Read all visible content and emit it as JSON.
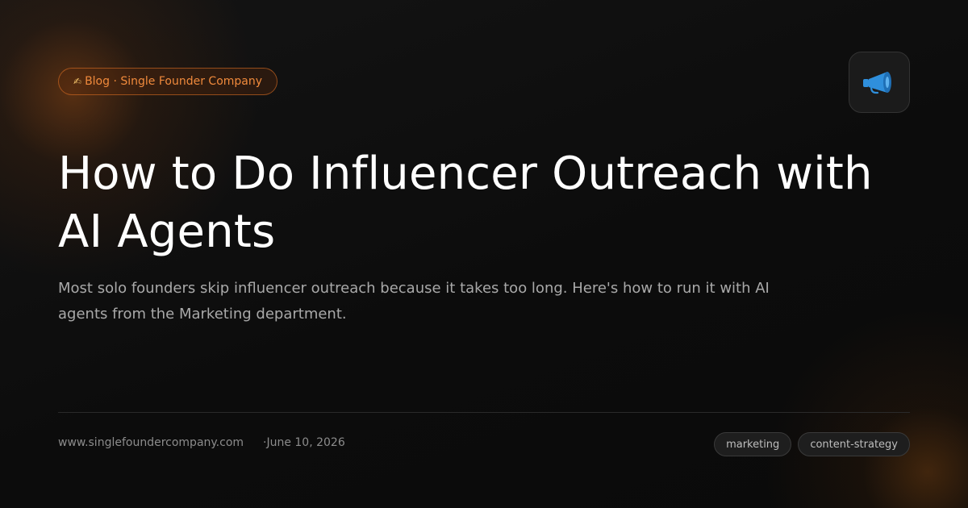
{
  "badge": {
    "icon": "writing-hand-icon",
    "text": "Blog · Single Founder Company"
  },
  "app_icon": "megaphone-icon",
  "title": "How to Do Influencer Outreach with AI Agents",
  "subtitle": "Most solo founders skip influencer outreach because it takes too long. Here's how to run it with AI agents from the Marketing department.",
  "footer": {
    "site": "www.singlefoundercompany.com",
    "date": "·June 10, 2026",
    "tags": [
      "marketing",
      "content-strategy"
    ]
  },
  "colors": {
    "accent": "#f08a3c",
    "megaphone": "#2f8fdc"
  }
}
